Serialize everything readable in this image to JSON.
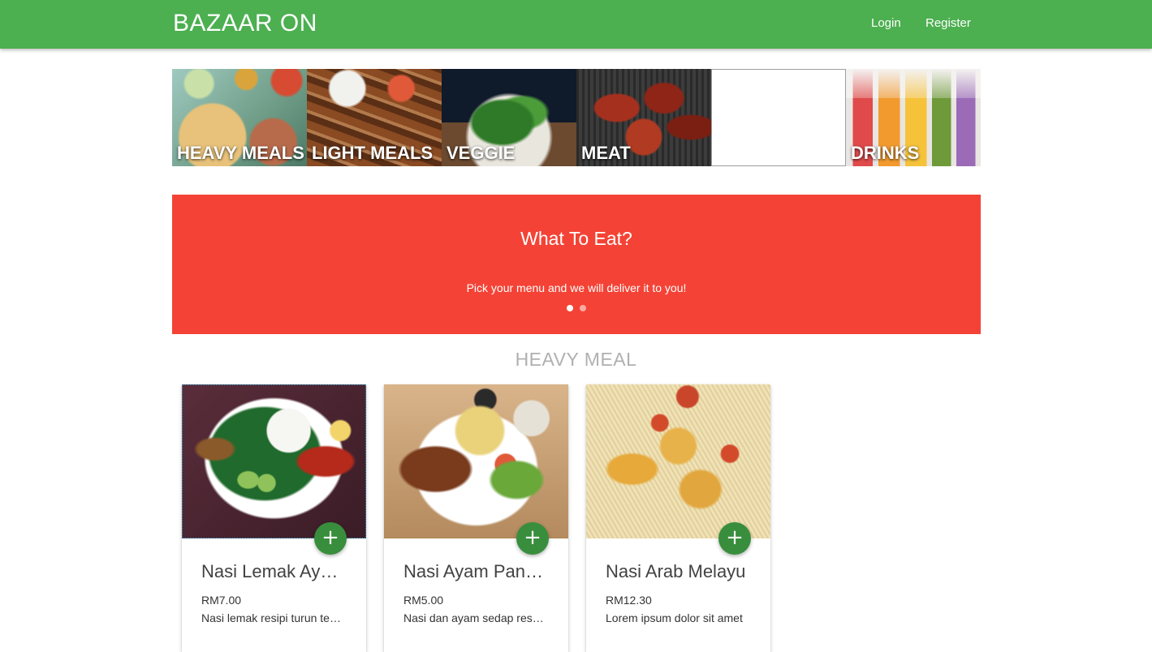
{
  "navbar": {
    "brand": "BAZAAR ON",
    "login": "Login",
    "register": "Register",
    "color": "#4caf50"
  },
  "categories": [
    {
      "label": "HEAVY MEALS"
    },
    {
      "label": "LIGHT MEALS"
    },
    {
      "label": "VEGGIE"
    },
    {
      "label": "MEAT"
    },
    {
      "label": ""
    },
    {
      "label": "DRINKS"
    }
  ],
  "banner": {
    "title": "What To Eat?",
    "subtitle": "Pick your menu and we will deliver it to you!",
    "color": "#f44336",
    "active_slide": 1,
    "slide_count": 2
  },
  "section": {
    "title": "HEAVY MEAL"
  },
  "products": [
    {
      "name": "Nasi Lemak Ayam Berempah",
      "price": "RM7.00",
      "description": "Nasi lemak resipi turun temurun",
      "add_icon": "+"
    },
    {
      "name": "Nasi Ayam Panggang",
      "price": "RM5.00",
      "description": "Nasi dan ayam sedap resepi keluarga",
      "add_icon": "+"
    },
    {
      "name": "Nasi Arab Melayu",
      "price": "RM12.30",
      "description": "Lorem ipsum dolor sit amet",
      "add_icon": "+"
    }
  ],
  "colors": {
    "fab": "#388e3c",
    "section_title": "#b0b0b0"
  }
}
